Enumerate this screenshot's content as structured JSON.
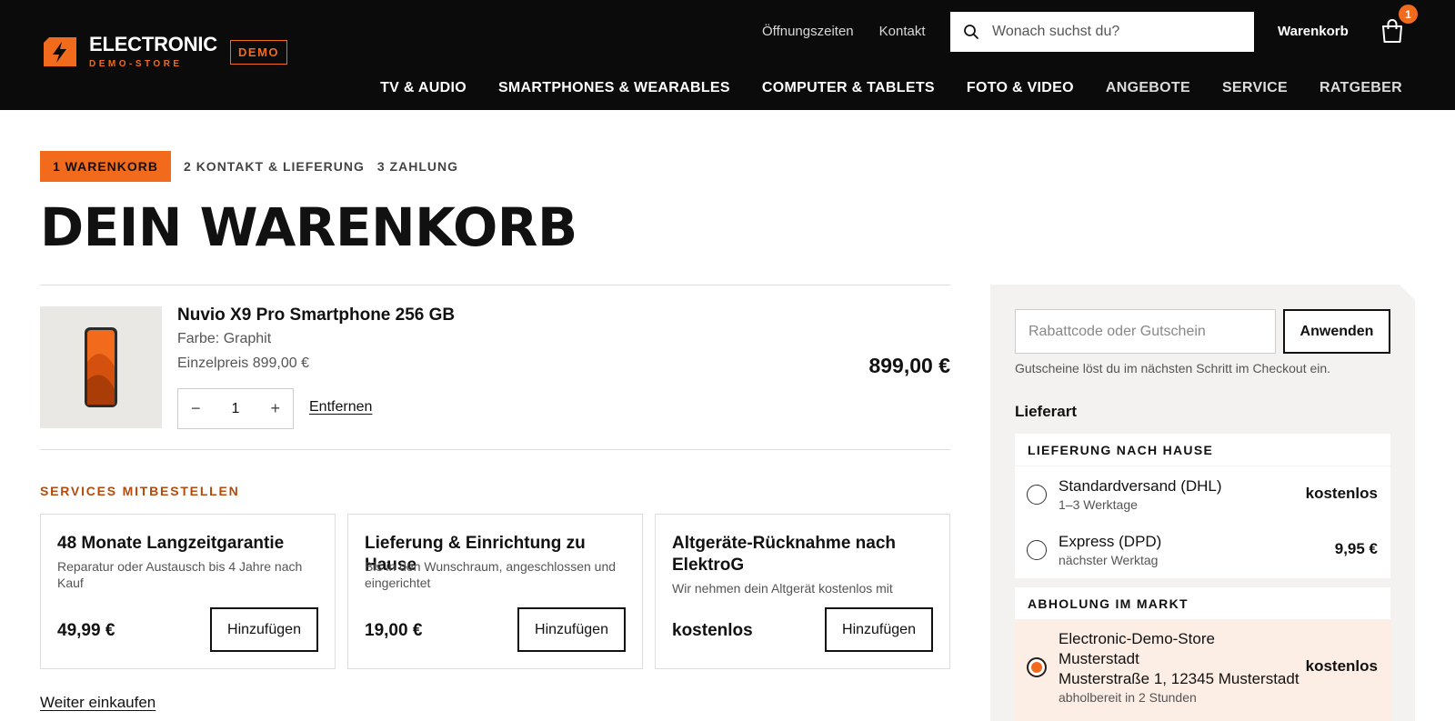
{
  "brand": {
    "name": "ELECTRONIC",
    "sub": "DEMO-STORE",
    "badge": "DEMO",
    "accent": "#f26b1d"
  },
  "header": {
    "links": [
      "Öffnungszeiten",
      "Kontakt"
    ],
    "search_placeholder": "Wonach suchst du?",
    "cart_label": "Warenkorb",
    "cart_count": "1",
    "nav": [
      "TV & AUDIO",
      "SMARTPHONES & WEARABLES",
      "COMPUTER & TABLETS",
      "FOTO & VIDEO",
      "ANGEBOTE",
      "SERVICE",
      "RATGEBER"
    ]
  },
  "steps": {
    "active": "1 WARENKORB",
    "others": [
      "2 KONTAKT & LIEFERUNG",
      "3 ZAHLUNG"
    ]
  },
  "page_title": "DEIN WARENKORB",
  "cart_item": {
    "name": "Nuvio X9 Pro Smartphone 256 GB",
    "color": "Farbe: Graphit",
    "unit_price": "Einzelpreis 899,00 €",
    "quantity": "1",
    "minus": "−",
    "plus": "+",
    "remove": "Entfernen",
    "total": "899,00 €"
  },
  "services": {
    "heading": "SERVICES MITBESTELLEN",
    "items": [
      {
        "title": "48 Monate Langzeitgarantie",
        "desc": "Reparatur oder Austausch bis 4 Jahre nach Kauf",
        "price": "49,99 €",
        "button": "Hinzufügen"
      },
      {
        "title": "Lieferung & Einrichtung zu Hause",
        "desc": "Bis in den Wunschraum, angeschlossen und eingerichtet",
        "price": "19,00 €",
        "button": "Hinzufügen"
      },
      {
        "title": "Altgeräte-Rücknahme nach ElektroG",
        "desc": "Wir nehmen dein Altgerät kostenlos mit",
        "price": "kostenlos",
        "button": "Hinzufügen"
      }
    ]
  },
  "continue_shopping": "Weiter einkaufen",
  "sidebar": {
    "coupon_placeholder": "Rabattcode oder Gutschein",
    "apply": "Anwenden",
    "coupon_hint": "Gutscheine löst du im nächsten Schritt im Checkout ein.",
    "delivery_heading": "Lieferart",
    "home_group": "LIEFERUNG NACH HAUSE",
    "options_home": [
      {
        "name": "Standardversand (DHL)",
        "sub": "1–3 Werktage",
        "price": "kostenlos"
      },
      {
        "name": "Express (DPD)",
        "sub": "nächster Werktag",
        "price": "9,95 €"
      }
    ],
    "pickup_group": "ABHOLUNG IM MARKT",
    "pickup": {
      "name_line1": "Electronic-Demo-Store",
      "name_line2": "Musterstadt",
      "address": "Musterstraße 1, 12345 Musterstadt",
      "sub": "abholbereit in 2 Stunden",
      "price": "kostenlos",
      "selected": true
    }
  }
}
